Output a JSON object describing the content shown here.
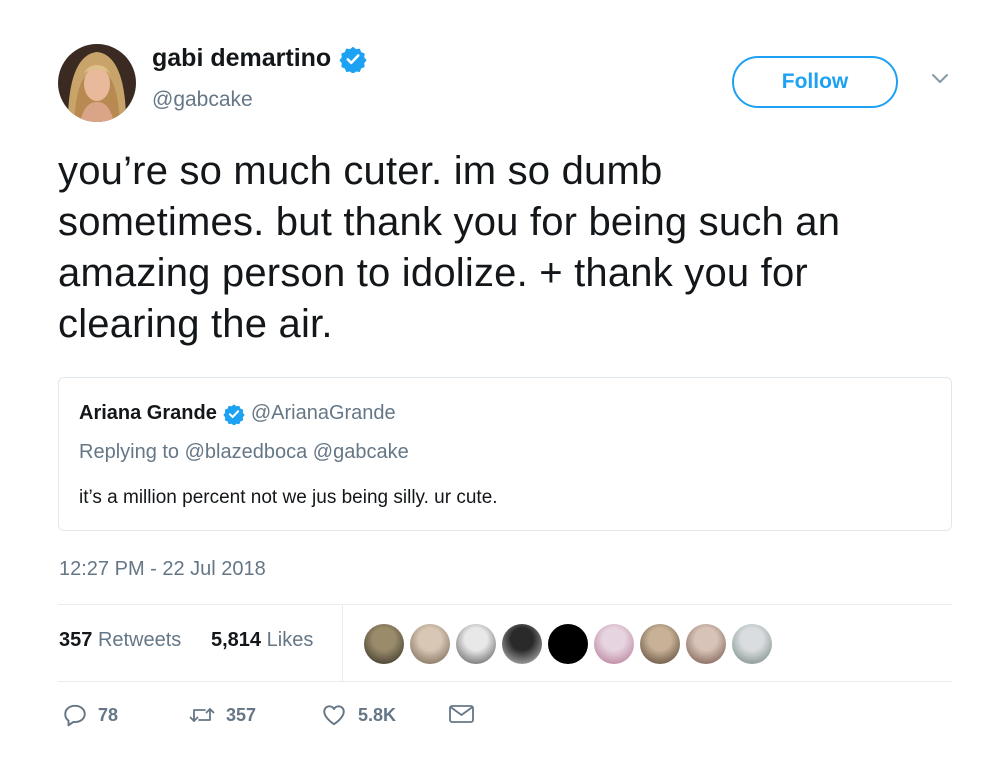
{
  "author": {
    "name": "gabi demartino",
    "handle": "@gabcake",
    "avatar_icon": "profile-photo",
    "verified": true
  },
  "follow_button": {
    "label": "Follow"
  },
  "caret_icon": "chevron-down-icon",
  "tweet": {
    "lines": [
      "you’re so much cuter. im so dumb",
      "sometimes. but thank you for being such an",
      "amazing person to idolize. + thank you for",
      "clearing the air."
    ]
  },
  "quoted_tweet": {
    "name": "Ariana Grande",
    "handle": "@ArianaGrande",
    "verified": true,
    "replying_prefix": "Replying to",
    "replying_mentions": [
      "@blazedboca",
      "@gabcake"
    ],
    "text": "it’s a million percent not we jus being silly. ur cute."
  },
  "timestamp": "12:27 PM - 22 Jul 2018",
  "stats": {
    "retweets_count": "357",
    "retweets_label": "Retweets",
    "likes_count": "5,814",
    "likes_label": "Likes"
  },
  "likers": [
    {
      "name": "liker-1",
      "colors": [
        "#9a8c6a",
        "#2b2620"
      ]
    },
    {
      "name": "liker-2",
      "colors": [
        "#d8c7b4",
        "#6b5a48"
      ]
    },
    {
      "name": "liker-3",
      "colors": [
        "#e8e8e8",
        "#4a4a4a"
      ]
    },
    {
      "name": "liker-4",
      "colors": [
        "#2a2a2a",
        "#cfcfcf"
      ]
    },
    {
      "name": "liker-5",
      "colors": [
        "#000000",
        "#000000"
      ]
    },
    {
      "name": "liker-6",
      "colors": [
        "#e6d4e0",
        "#b07090"
      ]
    },
    {
      "name": "liker-7",
      "colors": [
        "#c8b196",
        "#4a3a2c"
      ]
    },
    {
      "name": "liker-8",
      "colors": [
        "#d8c3b8",
        "#6a4c3e"
      ]
    },
    {
      "name": "liker-9",
      "colors": [
        "#d9dde0",
        "#6d7f78"
      ]
    }
  ],
  "actions": {
    "reply_count": "78",
    "retweet_count": "357",
    "like_count": "5.8K"
  },
  "colors": {
    "accent": "#1da1f2",
    "text": "#14171a",
    "muted": "#657786",
    "border": "#e6ecf0"
  }
}
